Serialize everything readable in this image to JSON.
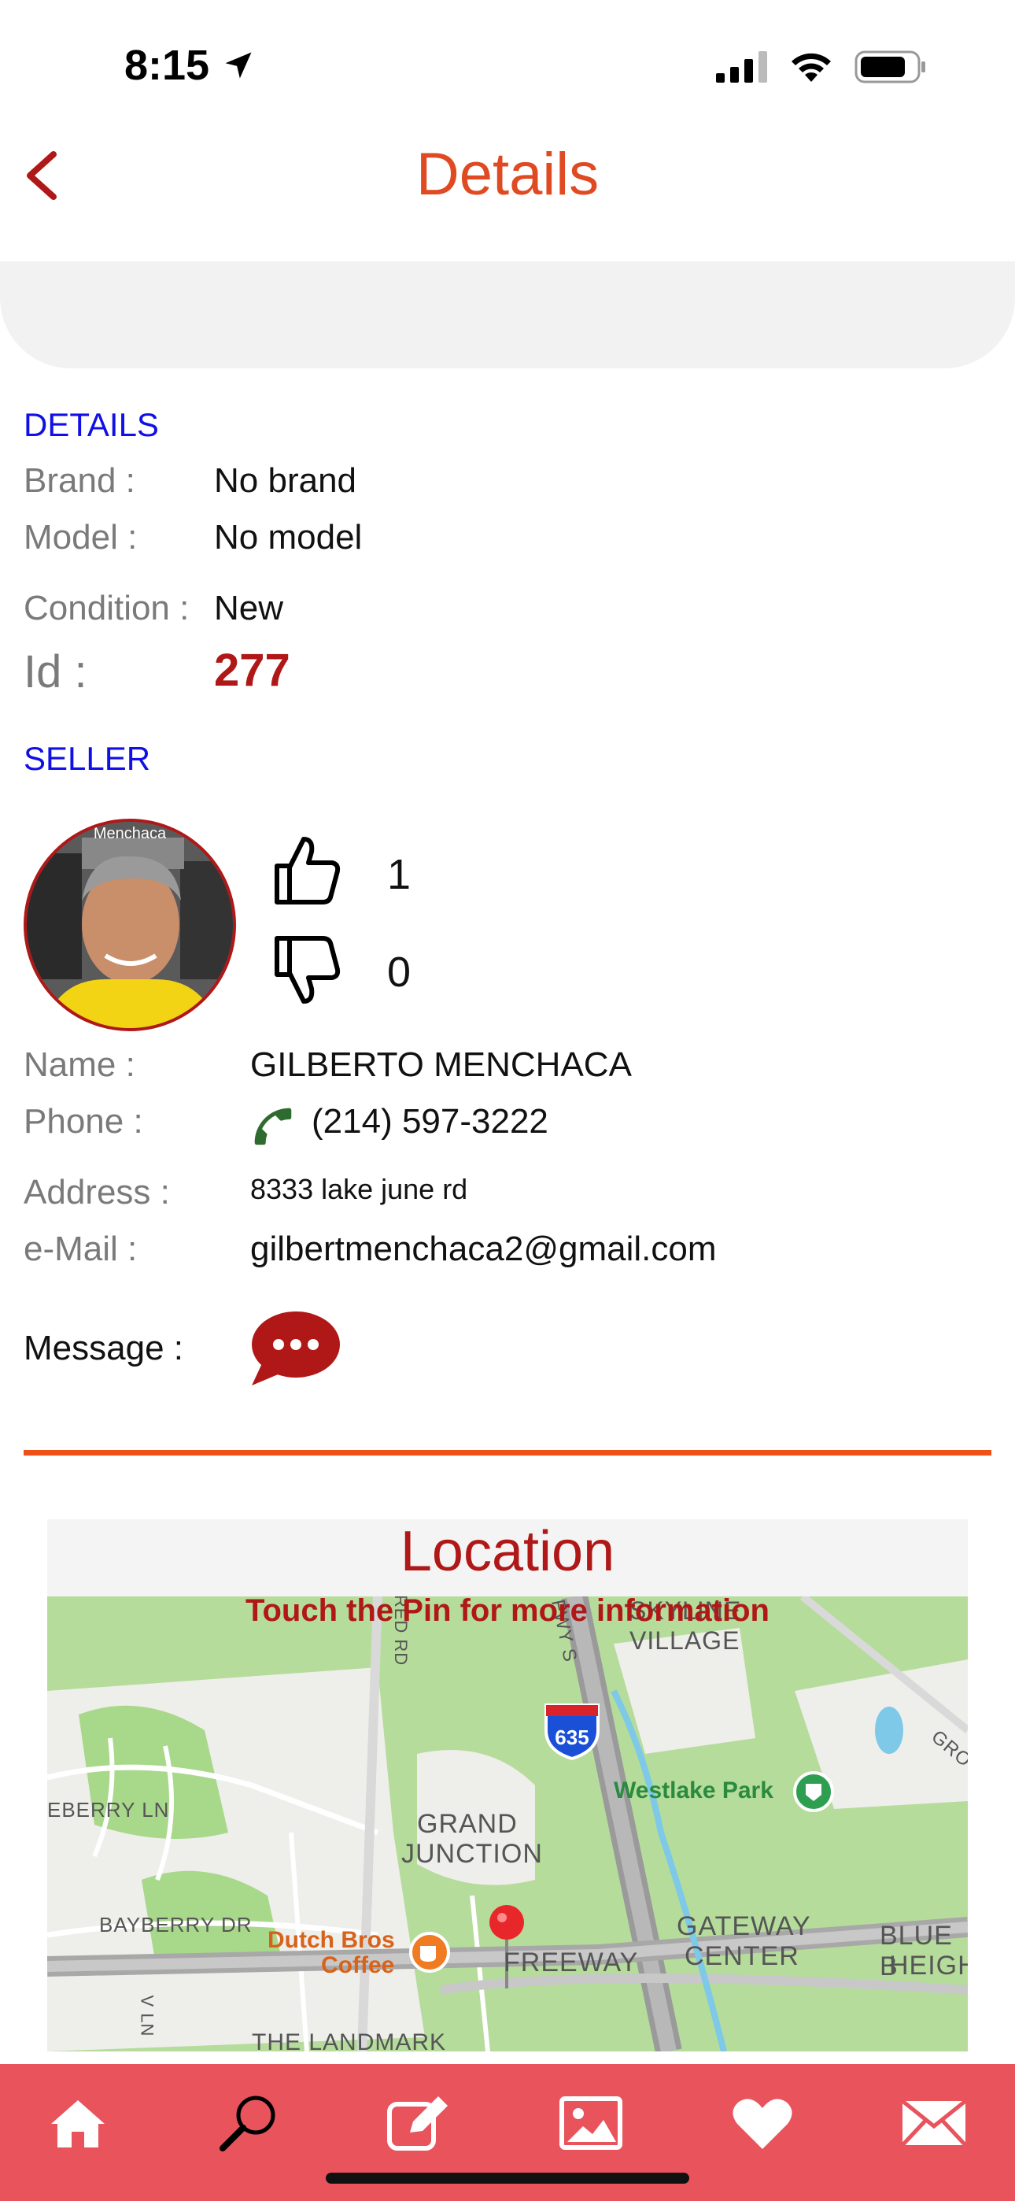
{
  "status_bar": {
    "time": "8:15"
  },
  "header": {
    "title": "Details"
  },
  "details": {
    "section_title": "DETAILS",
    "brand_label": "Brand :",
    "brand_value": "No brand",
    "model_label": "Model :",
    "model_value": "No model",
    "condition_label": "Condition :",
    "condition_value": "New",
    "id_label": "Id :",
    "id_value": "277"
  },
  "seller": {
    "section_title": "SELLER",
    "avatar_caption": "Menchaca",
    "likes": "1",
    "dislikes": "0",
    "name_label": "Name :",
    "name_value": "GILBERTO MENCHACA",
    "phone_label": "Phone :",
    "phone_value": "(214) 597-3222",
    "address_label": "Address :",
    "address_value": "8333 lake june rd",
    "email_label": "e-Mail :",
    "email_value": "gilbertmenchaca2@gmail.com",
    "message_label": "Message :"
  },
  "location": {
    "title": "Location",
    "note": "Touch the Pin for more information",
    "map_labels": {
      "skyline": "SKYLINE",
      "village": "VILLAGE",
      "westlake": "Westlake Park",
      "grand": "GRAND",
      "junction": "JUNCTION",
      "gateway": "GATEWAY",
      "center": "CENTER",
      "blue": "BLUE B",
      "heigh": "HEIGH",
      "freeway": "FREEWAY",
      "dutch1": "Dutch Bros",
      "dutch2": "Coffee",
      "bayberry_ln": "EBERRY LN",
      "bayberry_dr": "BAYBERRY DR",
      "landmark": "THE LANDMARK",
      "highway": "635",
      "road_red": "RED RD",
      "road_fwy": "FWY S",
      "road_gro": "GRO",
      "road_vln": "V LN"
    }
  },
  "colors": {
    "accent": "#e04a22",
    "dark_red": "#b01818",
    "tabbar": "#e8535c",
    "link_blue": "#1010e6"
  },
  "tabbar": {
    "items": [
      "home-icon",
      "search-icon",
      "edit-icon",
      "gallery-icon",
      "favorites-icon",
      "mail-icon"
    ]
  }
}
